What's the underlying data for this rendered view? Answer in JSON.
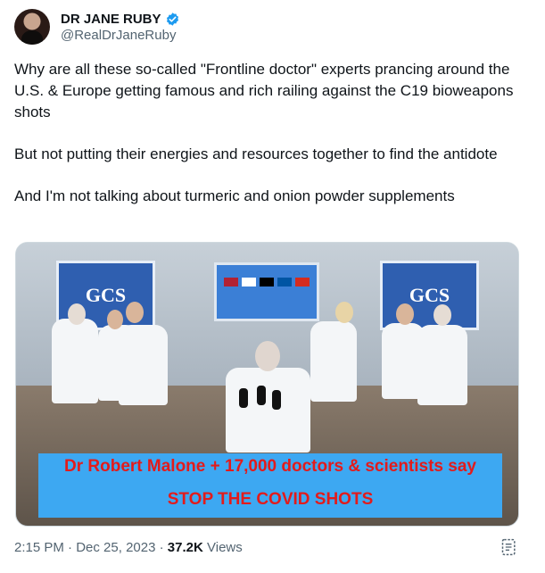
{
  "author": {
    "name": "DR JANE RUBY",
    "handle": "@RealDrJaneRuby",
    "verified_color": "#1d9bf0"
  },
  "post": {
    "paragraphs": [
      "Why are all these so-called \"Frontline doctor\" experts prancing around the U.S. &  Europe getting famous and rich railing against the C19 bioweapons shots",
      "But not putting their energies and resources together to find the antidote",
      "And I'm not talking about turmeric and onion powder supplements"
    ]
  },
  "media": {
    "panel_text": "GCS",
    "banner_line1": "Dr Robert Malone + 17,000 doctors & scientists say",
    "banner_line2": "STOP THE COVID SHOTS"
  },
  "meta": {
    "time": "2:15 PM",
    "separator": "·",
    "date": "Dec 25, 2023",
    "views_count": "37.2K",
    "views_label": "Views"
  }
}
